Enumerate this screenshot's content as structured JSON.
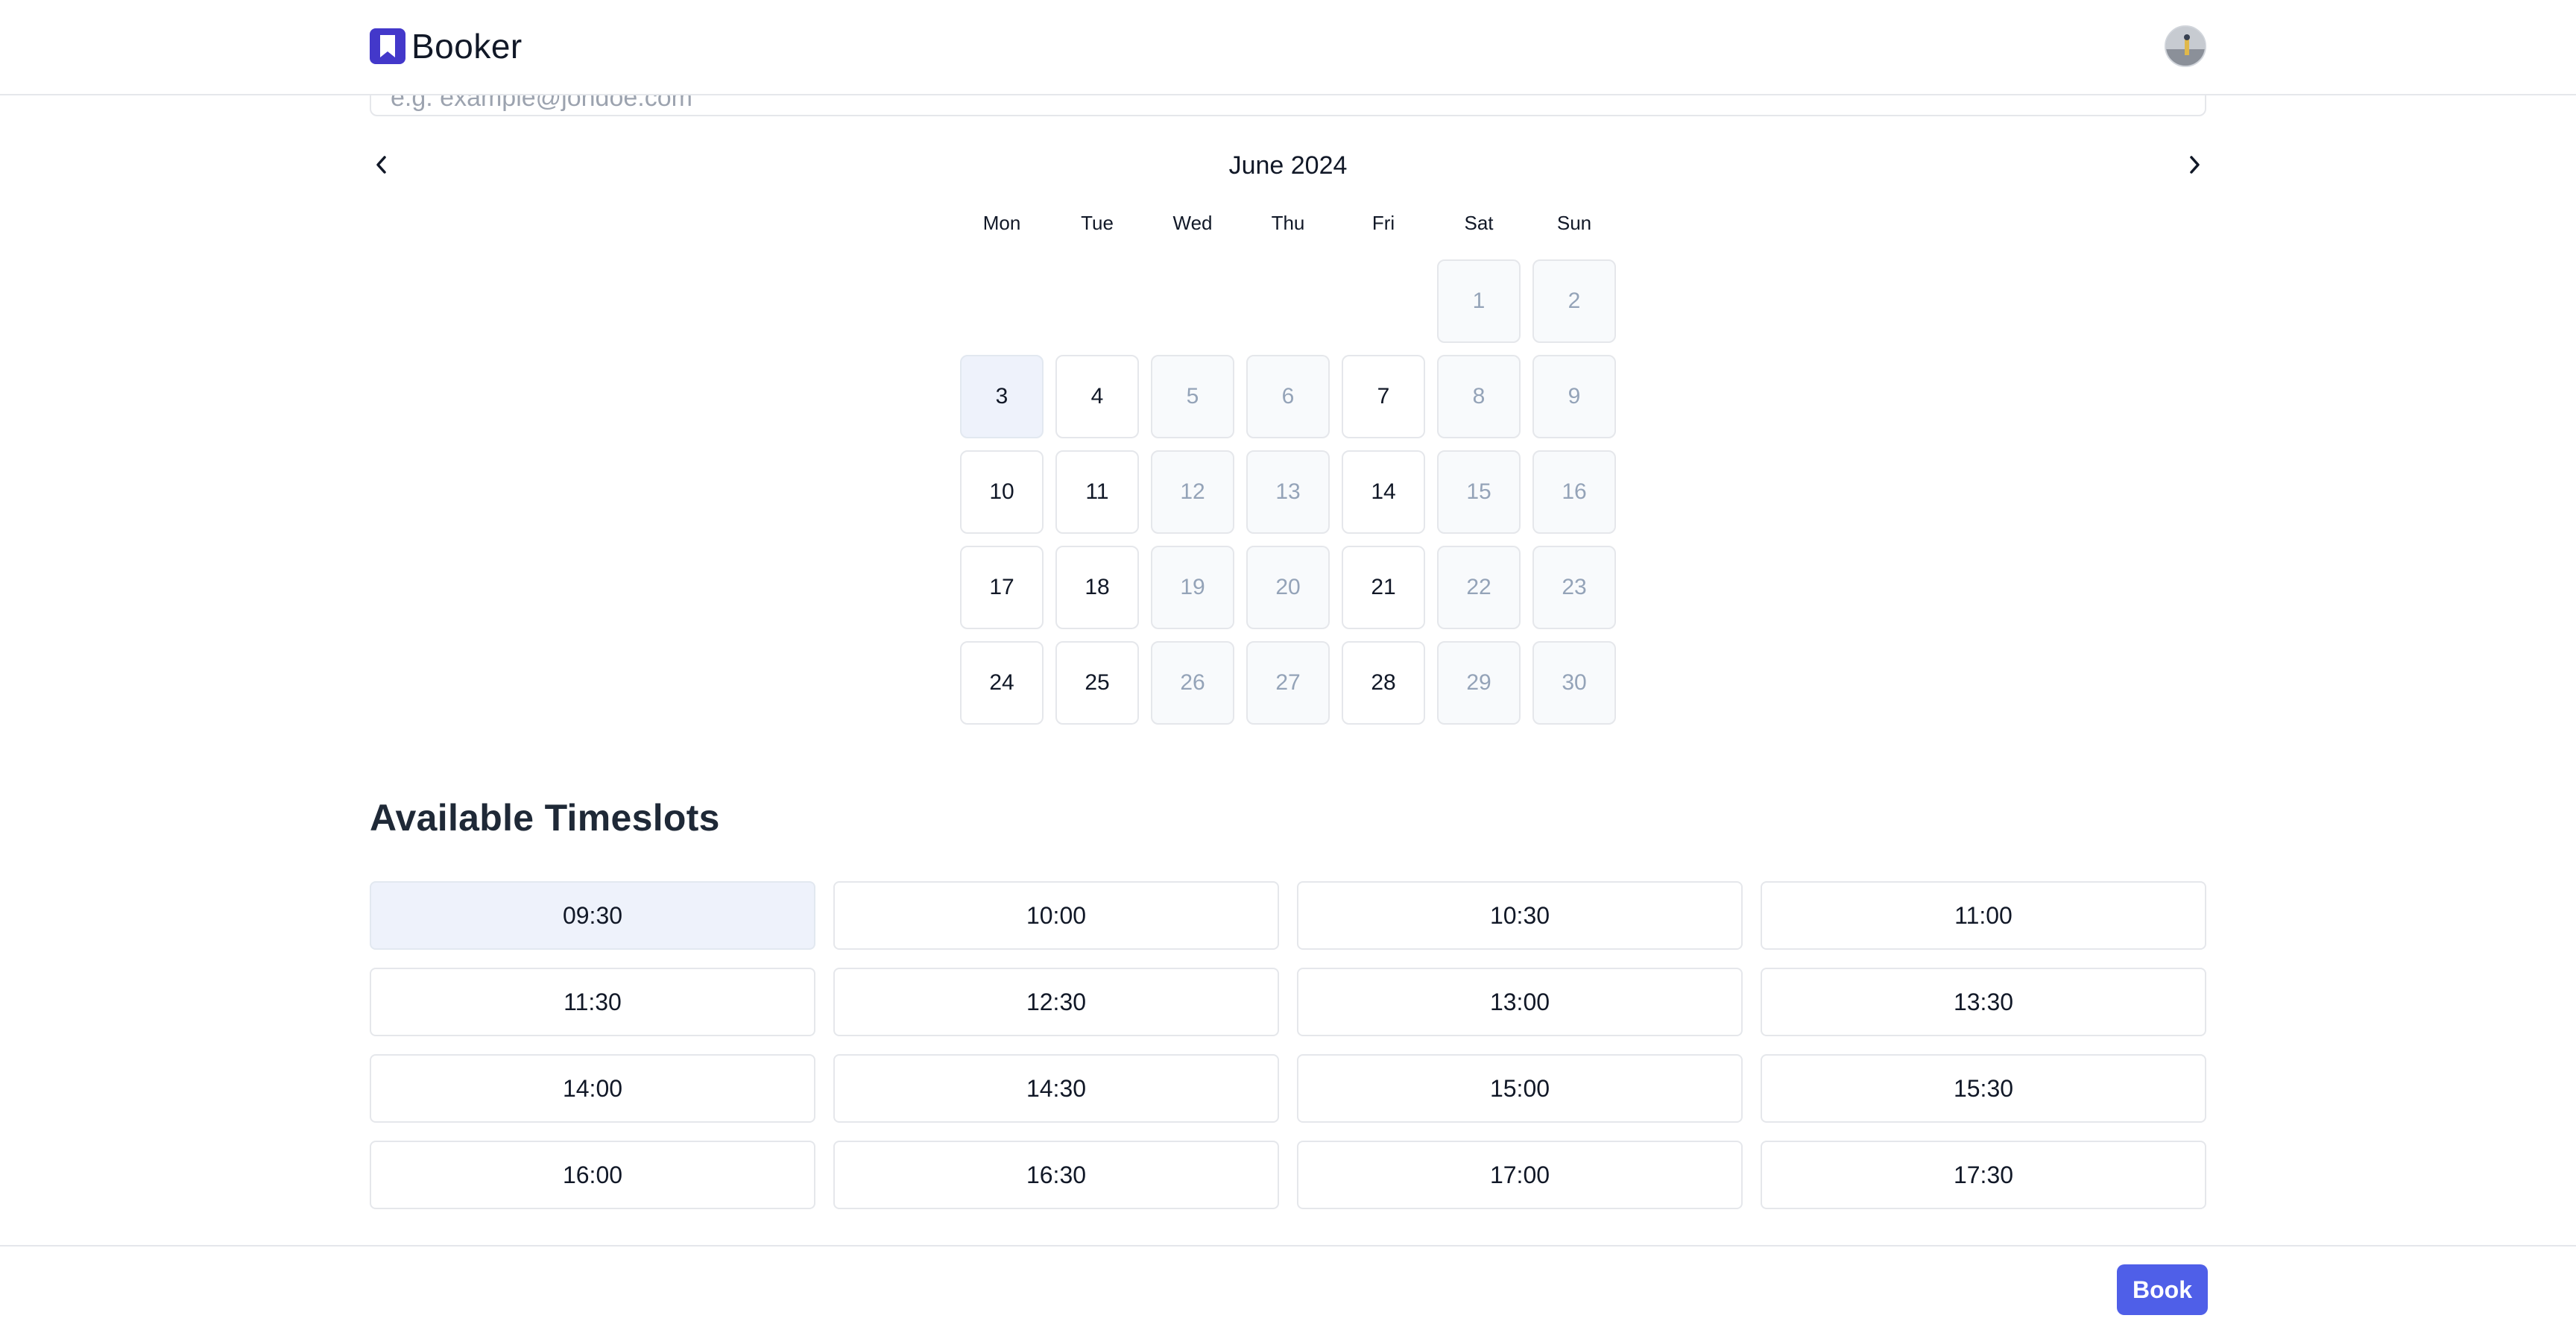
{
  "header": {
    "brand_name": "Booker",
    "logo_icon": "bookmark-icon",
    "avatar_icon": "user-avatar"
  },
  "email": {
    "placeholder": "e.g. example@johdoe.com",
    "value": ""
  },
  "calendar": {
    "month_label": "June 2024",
    "prev_icon": "chevron-left-icon",
    "next_icon": "chevron-right-icon",
    "weekdays": [
      "Mon",
      "Tue",
      "Wed",
      "Thu",
      "Fri",
      "Sat",
      "Sun"
    ],
    "days": [
      {
        "label": "",
        "state": "blank"
      },
      {
        "label": "",
        "state": "blank"
      },
      {
        "label": "",
        "state": "blank"
      },
      {
        "label": "",
        "state": "blank"
      },
      {
        "label": "",
        "state": "blank"
      },
      {
        "label": "1",
        "state": "disabled"
      },
      {
        "label": "2",
        "state": "disabled"
      },
      {
        "label": "3",
        "state": "selected"
      },
      {
        "label": "4",
        "state": "available"
      },
      {
        "label": "5",
        "state": "disabled"
      },
      {
        "label": "6",
        "state": "disabled"
      },
      {
        "label": "7",
        "state": "available"
      },
      {
        "label": "8",
        "state": "disabled"
      },
      {
        "label": "9",
        "state": "disabled"
      },
      {
        "label": "10",
        "state": "available"
      },
      {
        "label": "11",
        "state": "available"
      },
      {
        "label": "12",
        "state": "disabled"
      },
      {
        "label": "13",
        "state": "disabled"
      },
      {
        "label": "14",
        "state": "available"
      },
      {
        "label": "15",
        "state": "disabled"
      },
      {
        "label": "16",
        "state": "disabled"
      },
      {
        "label": "17",
        "state": "available"
      },
      {
        "label": "18",
        "state": "available"
      },
      {
        "label": "19",
        "state": "disabled"
      },
      {
        "label": "20",
        "state": "disabled"
      },
      {
        "label": "21",
        "state": "available"
      },
      {
        "label": "22",
        "state": "disabled"
      },
      {
        "label": "23",
        "state": "disabled"
      },
      {
        "label": "24",
        "state": "available"
      },
      {
        "label": "25",
        "state": "available"
      },
      {
        "label": "26",
        "state": "disabled"
      },
      {
        "label": "27",
        "state": "disabled"
      },
      {
        "label": "28",
        "state": "available"
      },
      {
        "label": "29",
        "state": "disabled"
      },
      {
        "label": "30",
        "state": "disabled"
      }
    ]
  },
  "timeslots": {
    "title": "Available Timeslots",
    "selected": "09:30",
    "slots": [
      "09:30",
      "10:00",
      "10:30",
      "11:00",
      "11:30",
      "12:30",
      "13:00",
      "13:30",
      "14:00",
      "14:30",
      "15:00",
      "15:30",
      "16:00",
      "16:30",
      "17:00",
      "17:30"
    ]
  },
  "footer": {
    "book_label": "Book"
  },
  "colors": {
    "brand": "#4338ca",
    "primary_button": "#4f5fe8",
    "selected_bg": "#eef2fb",
    "disabled_text": "#94a3b8"
  }
}
